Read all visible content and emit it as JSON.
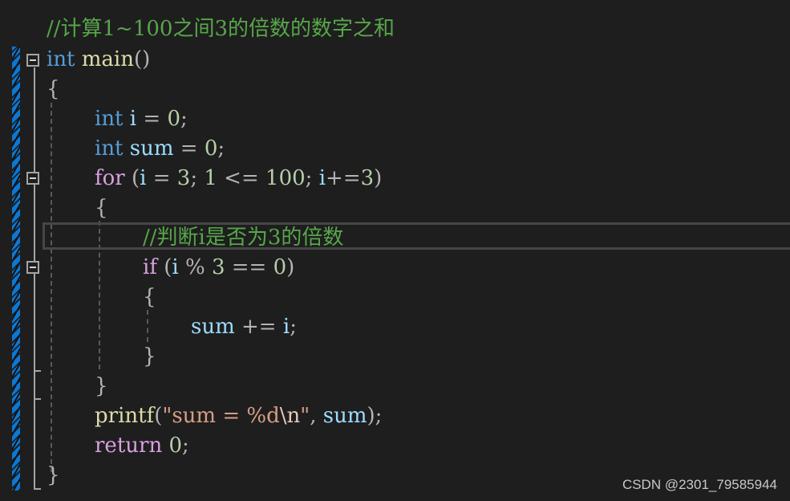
{
  "editor": {
    "lines": [
      {
        "indent": 0,
        "tokens": [
          {
            "t": "//计算1~100之间3的倍数的数字之和",
            "c": "cm"
          }
        ]
      },
      {
        "indent": 0,
        "tokens": [
          {
            "t": "int",
            "c": "kw"
          },
          {
            "t": " ",
            "c": ""
          },
          {
            "t": "main",
            "c": "fn"
          },
          {
            "t": "()",
            "c": "punc"
          }
        ]
      },
      {
        "indent": 0,
        "tokens": [
          {
            "t": "{",
            "c": "punc"
          }
        ]
      },
      {
        "indent": 1,
        "tokens": [
          {
            "t": "int",
            "c": "kw"
          },
          {
            "t": " ",
            "c": ""
          },
          {
            "t": "i",
            "c": "var"
          },
          {
            "t": " = ",
            "c": "op"
          },
          {
            "t": "0",
            "c": "num"
          },
          {
            "t": ";",
            "c": "punc"
          }
        ]
      },
      {
        "indent": 1,
        "tokens": [
          {
            "t": "int",
            "c": "kw"
          },
          {
            "t": " ",
            "c": ""
          },
          {
            "t": "sum",
            "c": "var"
          },
          {
            "t": " = ",
            "c": "op"
          },
          {
            "t": "0",
            "c": "num"
          },
          {
            "t": ";",
            "c": "punc"
          }
        ]
      },
      {
        "indent": 1,
        "tokens": [
          {
            "t": "for",
            "c": "ctl"
          },
          {
            "t": " (",
            "c": "punc"
          },
          {
            "t": "i",
            "c": "var"
          },
          {
            "t": " = ",
            "c": "op"
          },
          {
            "t": "3",
            "c": "num"
          },
          {
            "t": "; ",
            "c": "punc"
          },
          {
            "t": "1",
            "c": "num"
          },
          {
            "t": " <= ",
            "c": "op"
          },
          {
            "t": "100",
            "c": "num"
          },
          {
            "t": "; ",
            "c": "punc"
          },
          {
            "t": "i",
            "c": "var"
          },
          {
            "t": "+=",
            "c": "op"
          },
          {
            "t": "3",
            "c": "num"
          },
          {
            "t": ")",
            "c": "punc"
          }
        ]
      },
      {
        "indent": 1,
        "tokens": [
          {
            "t": "{",
            "c": "punc"
          }
        ]
      },
      {
        "indent": 2,
        "tokens": [
          {
            "t": "//判断i是否为3的倍数",
            "c": "cm"
          }
        ]
      },
      {
        "indent": 2,
        "tokens": [
          {
            "t": "if",
            "c": "ctl"
          },
          {
            "t": " (",
            "c": "punc"
          },
          {
            "t": "i",
            "c": "var"
          },
          {
            "t": " % ",
            "c": "op"
          },
          {
            "t": "3",
            "c": "num"
          },
          {
            "t": " == ",
            "c": "op"
          },
          {
            "t": "0",
            "c": "num"
          },
          {
            "t": ")",
            "c": "punc"
          }
        ]
      },
      {
        "indent": 2,
        "tokens": [
          {
            "t": "{",
            "c": "punc"
          }
        ]
      },
      {
        "indent": 3,
        "tokens": [
          {
            "t": "sum",
            "c": "var"
          },
          {
            "t": " += ",
            "c": "op"
          },
          {
            "t": "i",
            "c": "var"
          },
          {
            "t": ";",
            "c": "punc"
          }
        ]
      },
      {
        "indent": 2,
        "tokens": [
          {
            "t": "}",
            "c": "punc"
          }
        ]
      },
      {
        "indent": 1,
        "tokens": [
          {
            "t": "}",
            "c": "punc"
          }
        ]
      },
      {
        "indent": 1,
        "tokens": [
          {
            "t": "printf",
            "c": "fn"
          },
          {
            "t": "(",
            "c": "punc"
          },
          {
            "t": "\"sum = %d",
            "c": "str"
          },
          {
            "t": "\\n",
            "c": "esc"
          },
          {
            "t": "\"",
            "c": "str"
          },
          {
            "t": ", ",
            "c": "punc"
          },
          {
            "t": "sum",
            "c": "var"
          },
          {
            "t": ");",
            "c": "punc"
          }
        ]
      },
      {
        "indent": 1,
        "tokens": [
          {
            "t": "return",
            "c": "ctl"
          },
          {
            "t": " ",
            "c": ""
          },
          {
            "t": "0",
            "c": "num"
          },
          {
            "t": ";",
            "c": "punc"
          }
        ]
      },
      {
        "indent": 0,
        "tokens": [
          {
            "t": "}",
            "c": "punc"
          }
        ]
      }
    ]
  },
  "colors": {
    "background": "#1e1e1e",
    "change_bar": "#0a78d4",
    "keyword": "#569cd6",
    "control": "#d8a0df",
    "function": "#dcdcaa",
    "variable": "#9cdcfe",
    "number": "#b5cea8",
    "comment": "#57a64a",
    "string": "#d69d85"
  },
  "watermark": "CSDN @2301_79585944"
}
